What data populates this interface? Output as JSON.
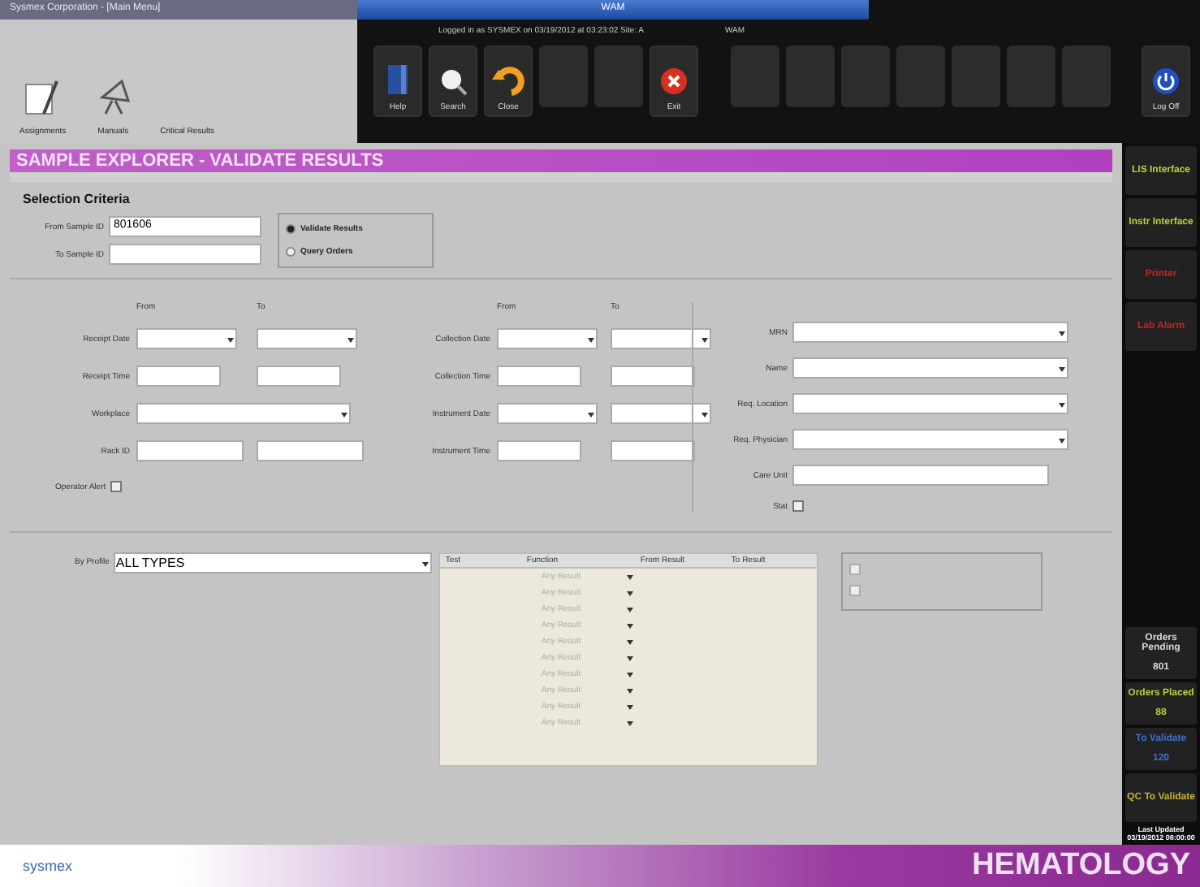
{
  "title_bar": {
    "app_title": "Sysmex Corporation - [Main Menu]",
    "session_title": "WAM",
    "session_info": "Logged in as SYSMEX on 03/19/2012 at 03:23:02   Site: A",
    "site_label": "WAM"
  },
  "launcher": [
    {
      "label": "Assignments",
      "kind": "notepad"
    },
    {
      "label": "Manuals",
      "kind": "satellite"
    },
    {
      "label": "Critical Results",
      "kind": "none"
    }
  ],
  "toolbar": [
    {
      "label": "Help",
      "kind": "help"
    },
    {
      "label": "Search",
      "kind": "search"
    },
    {
      "label": "Close",
      "kind": "close"
    },
    {
      "kind": "empty"
    },
    {
      "kind": "empty"
    },
    {
      "label": "Exit",
      "kind": "exit"
    }
  ],
  "toolbar_slots": [
    {
      "kind": "empty"
    },
    {
      "kind": "empty"
    },
    {
      "kind": "empty"
    },
    {
      "kind": "empty"
    },
    {
      "kind": "empty"
    },
    {
      "kind": "empty"
    },
    {
      "kind": "empty"
    }
  ],
  "logoff": {
    "label": "Log Off"
  },
  "page_title": "SAMPLE EXPLORER - VALIDATE RESULTS",
  "section_title": "Selection Criteria",
  "sample_range": {
    "from_label": "From Sample ID",
    "from_value": "801606",
    "to_label": "To Sample ID"
  },
  "modes": [
    {
      "label": "Validate Results",
      "selected": true
    },
    {
      "label": "Query Orders",
      "selected": false
    }
  ],
  "range_headers": [
    "From",
    "To",
    "From",
    "To"
  ],
  "range_rows": [
    {
      "left": {
        "label": "Receipt Date",
        "kind": "dates"
      },
      "right": {
        "label": "Collection Date",
        "kind": "dates"
      }
    },
    {
      "left": {
        "label": "Receipt Time",
        "kind": "times"
      },
      "right": {
        "label": "Collection Time",
        "kind": "times"
      }
    },
    {
      "left": {
        "label": "Workplace",
        "kind": "wide"
      },
      "right": {
        "label": "Instrument Date",
        "kind": "dates"
      }
    },
    {
      "left": {
        "label": "Rack ID",
        "kind": "rack"
      },
      "right": {
        "label": "Instrument Time",
        "kind": "times"
      }
    }
  ],
  "operator_alert": {
    "label": "Operator Alert",
    "checked": false
  },
  "patient_fields": [
    {
      "label": "MRN",
      "kind": "dropdown"
    },
    {
      "label": "Name",
      "kind": "dropdown"
    },
    {
      "label": "Req. Location",
      "kind": "dropdown"
    },
    {
      "label": "Req. Physician",
      "kind": "dropdown"
    },
    {
      "label": "Care Unit",
      "kind": "text"
    }
  ],
  "stat": {
    "label": "Stat",
    "checked": false
  },
  "profile": {
    "label": "By Profile",
    "value": "ALL TYPES"
  },
  "results_table": {
    "columns": [
      "Test",
      "Function",
      "From Result",
      "To Result"
    ],
    "rows": [
      {
        "function": "Any Result"
      },
      {
        "function": "Any Result"
      },
      {
        "function": "Any Result"
      },
      {
        "function": "Any Result"
      },
      {
        "function": "Any Result"
      },
      {
        "function": "Any Result"
      },
      {
        "function": "Any Result"
      },
      {
        "function": "Any Result"
      },
      {
        "function": "Any Result"
      },
      {
        "function": "Any Result"
      }
    ]
  },
  "flags": [
    {
      "checked": false,
      "disabled": true
    },
    {
      "checked": false,
      "disabled": true
    }
  ],
  "sidebar": [
    {
      "label": "LIS Interface",
      "color": "#b8d040",
      "kind": "status"
    },
    {
      "label": "Instr Interface",
      "color": "#b8d040",
      "kind": "status"
    },
    {
      "label": "Printer",
      "color": "#d02020",
      "kind": "status"
    },
    {
      "label": "Lab Alarm",
      "color": "#d02020",
      "kind": "status"
    },
    {
      "kind": "spacer"
    },
    {
      "label": "Orders Pending",
      "value": "801",
      "color": "#d8d8d8",
      "kind": "counter"
    },
    {
      "label": "Orders Placed",
      "value": "88",
      "color": "#b8d040",
      "kind": "counter"
    },
    {
      "label": "To Validate",
      "value": "120",
      "color": "#4070d0",
      "kind": "counter"
    },
    {
      "label": "QC To Validate",
      "color": "#c8b030",
      "kind": "status"
    },
    {
      "label": "Last Updated 03/19/2012 08:00:00",
      "kind": "note"
    }
  ],
  "footer": {
    "logo": "sysmex",
    "department": "HEMATOLOGY"
  }
}
